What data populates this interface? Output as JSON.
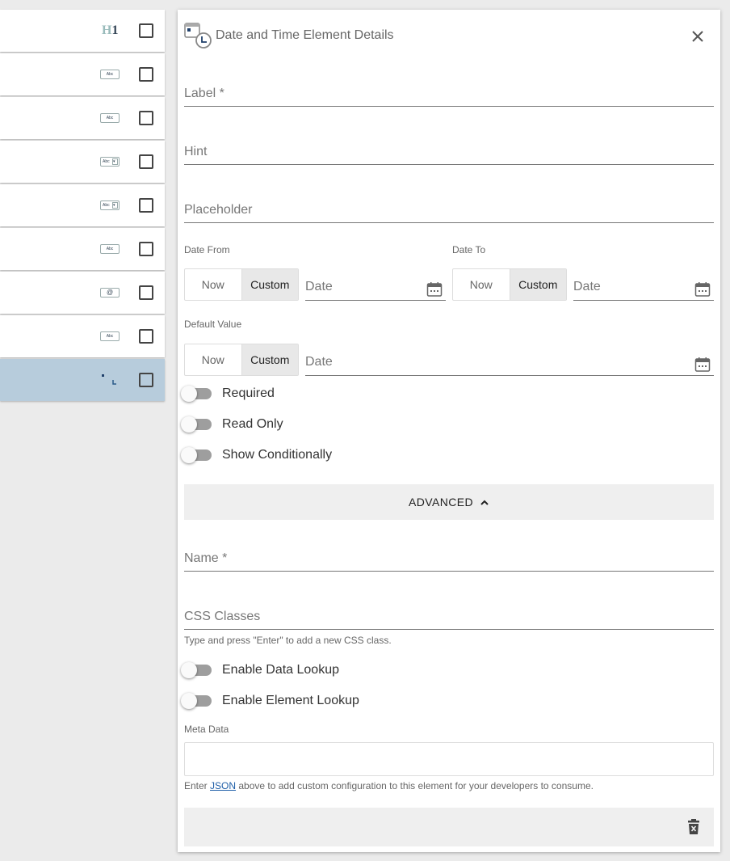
{
  "left_list": {
    "rows": [
      {
        "icon": "heading-h1-icon",
        "icon_text": "H",
        "icon_text2": "1",
        "selected": false
      },
      {
        "icon": "text-field-icon",
        "icon_text": "Abc",
        "selected": false
      },
      {
        "icon": "text-field-icon",
        "icon_text": "Abc",
        "selected": false
      },
      {
        "icon": "dropdown-icon",
        "icon_text": "Abc",
        "selected": false
      },
      {
        "icon": "dropdown-icon",
        "icon_text": "Abc",
        "selected": false
      },
      {
        "icon": "text-field-icon",
        "icon_text": "Abc",
        "selected": false
      },
      {
        "icon": "email-field-icon",
        "icon_text": "@",
        "selected": false
      },
      {
        "icon": "text-field-icon",
        "icon_text": "Abc",
        "selected": false
      },
      {
        "icon": "date-time-icon",
        "selected": true
      }
    ]
  },
  "panel": {
    "title": "Date and Time Element Details",
    "fields": {
      "label": "Label *",
      "hint": "Hint",
      "placeholder": "Placeholder"
    },
    "date_from": {
      "label": "Date From",
      "now": "Now",
      "custom": "Custom",
      "date_placeholder": "Date"
    },
    "date_to": {
      "label": "Date To",
      "now": "Now",
      "custom": "Custom",
      "date_placeholder": "Date"
    },
    "default_value": {
      "label": "Default Value",
      "now": "Now",
      "custom": "Custom",
      "date_placeholder": "Date"
    },
    "toggles": {
      "required": "Required",
      "read_only": "Read Only",
      "show_conditionally": "Show Conditionally",
      "enable_data_lookup": "Enable Data Lookup",
      "enable_element_lookup": "Enable Element Lookup"
    },
    "advanced": "ADVANCED",
    "name": "Name *",
    "css_classes": "CSS Classes",
    "css_hint": "Type and press \"Enter\" to add a new CSS class.",
    "meta_data_label": "Meta Data",
    "meta_hint_before": "Enter ",
    "meta_hint_link": "JSON",
    "meta_hint_after": " above to add custom configuration to this element for your developers to consume."
  },
  "colors": {
    "selected_row": "#b7ccdc",
    "toggle_track": "#9e9e9e",
    "link": "#1f5fa8"
  }
}
